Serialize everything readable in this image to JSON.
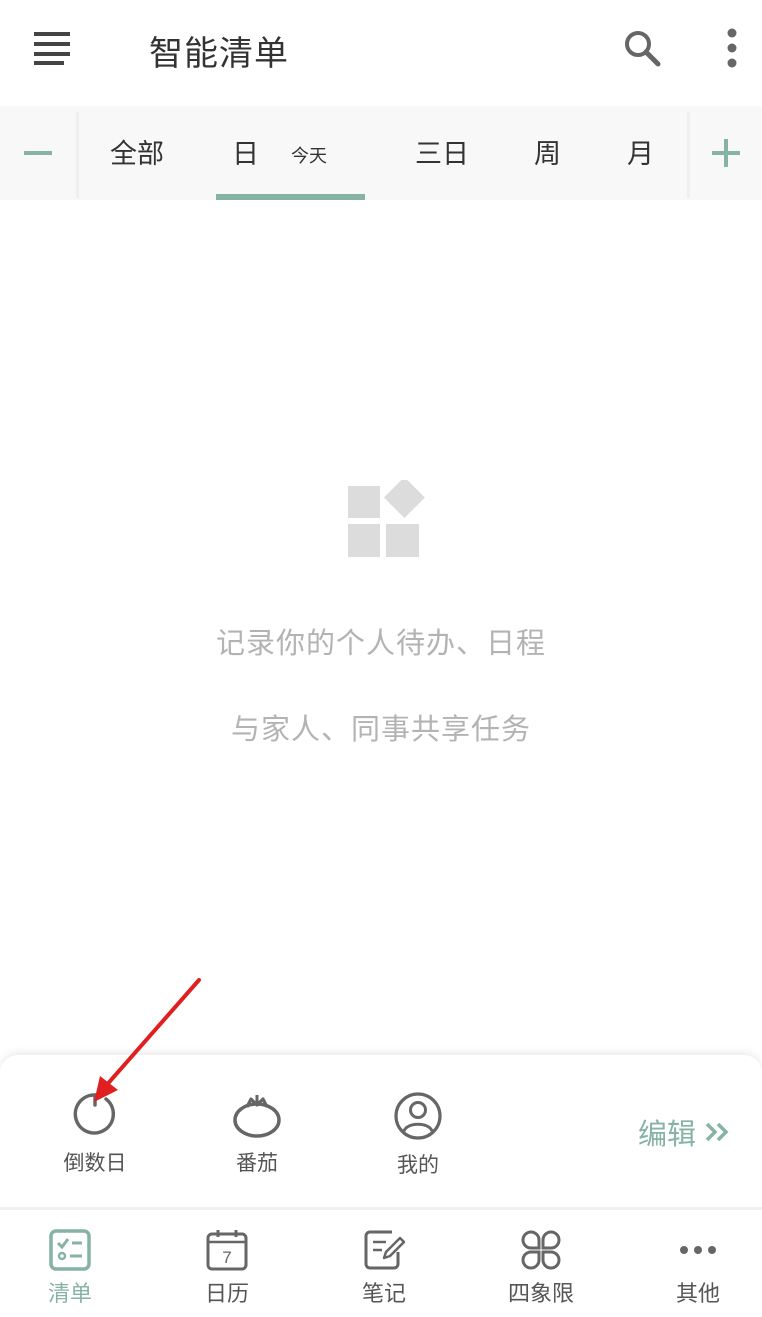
{
  "header": {
    "title": "智能清单",
    "menu_icon": "menu-icon",
    "search_icon": "search-icon",
    "more_icon": "more-vertical-icon"
  },
  "tabs": {
    "minus_icon": "minus-icon",
    "plus_icon": "plus-icon",
    "items": [
      {
        "label": "全部",
        "active": false
      },
      {
        "label": "日",
        "sub": "今天",
        "active": true
      },
      {
        "label": "三日",
        "active": false
      },
      {
        "label": "周",
        "active": false
      },
      {
        "label": "月",
        "active": false
      }
    ]
  },
  "empty_state": {
    "icon": "widgets-icon",
    "line1": "记录你的个人待办、日程",
    "line2": "与家人、同事共享任务"
  },
  "quick_bar": {
    "items": [
      {
        "label": "倒数日",
        "icon": "countdown-icon"
      },
      {
        "label": "番茄",
        "icon": "tomato-icon"
      },
      {
        "label": "我的",
        "icon": "profile-icon"
      }
    ],
    "edit_label": "编辑",
    "edit_icon": "double-chevron-right-icon"
  },
  "bottom_nav": {
    "items": [
      {
        "label": "清单",
        "icon": "checklist-icon",
        "active": true
      },
      {
        "label": "日历",
        "icon": "calendar-icon",
        "day": "7",
        "active": false
      },
      {
        "label": "笔记",
        "icon": "note-icon",
        "active": false
      },
      {
        "label": "四象限",
        "icon": "quadrant-icon",
        "active": false
      },
      {
        "label": "其他",
        "icon": "more-horizontal-icon",
        "active": false
      }
    ]
  },
  "colors": {
    "accent": "#86b3a3",
    "annotation_arrow": "#e02020",
    "icon_gray": "#555555",
    "empty_gray": "#b3b3b3"
  }
}
